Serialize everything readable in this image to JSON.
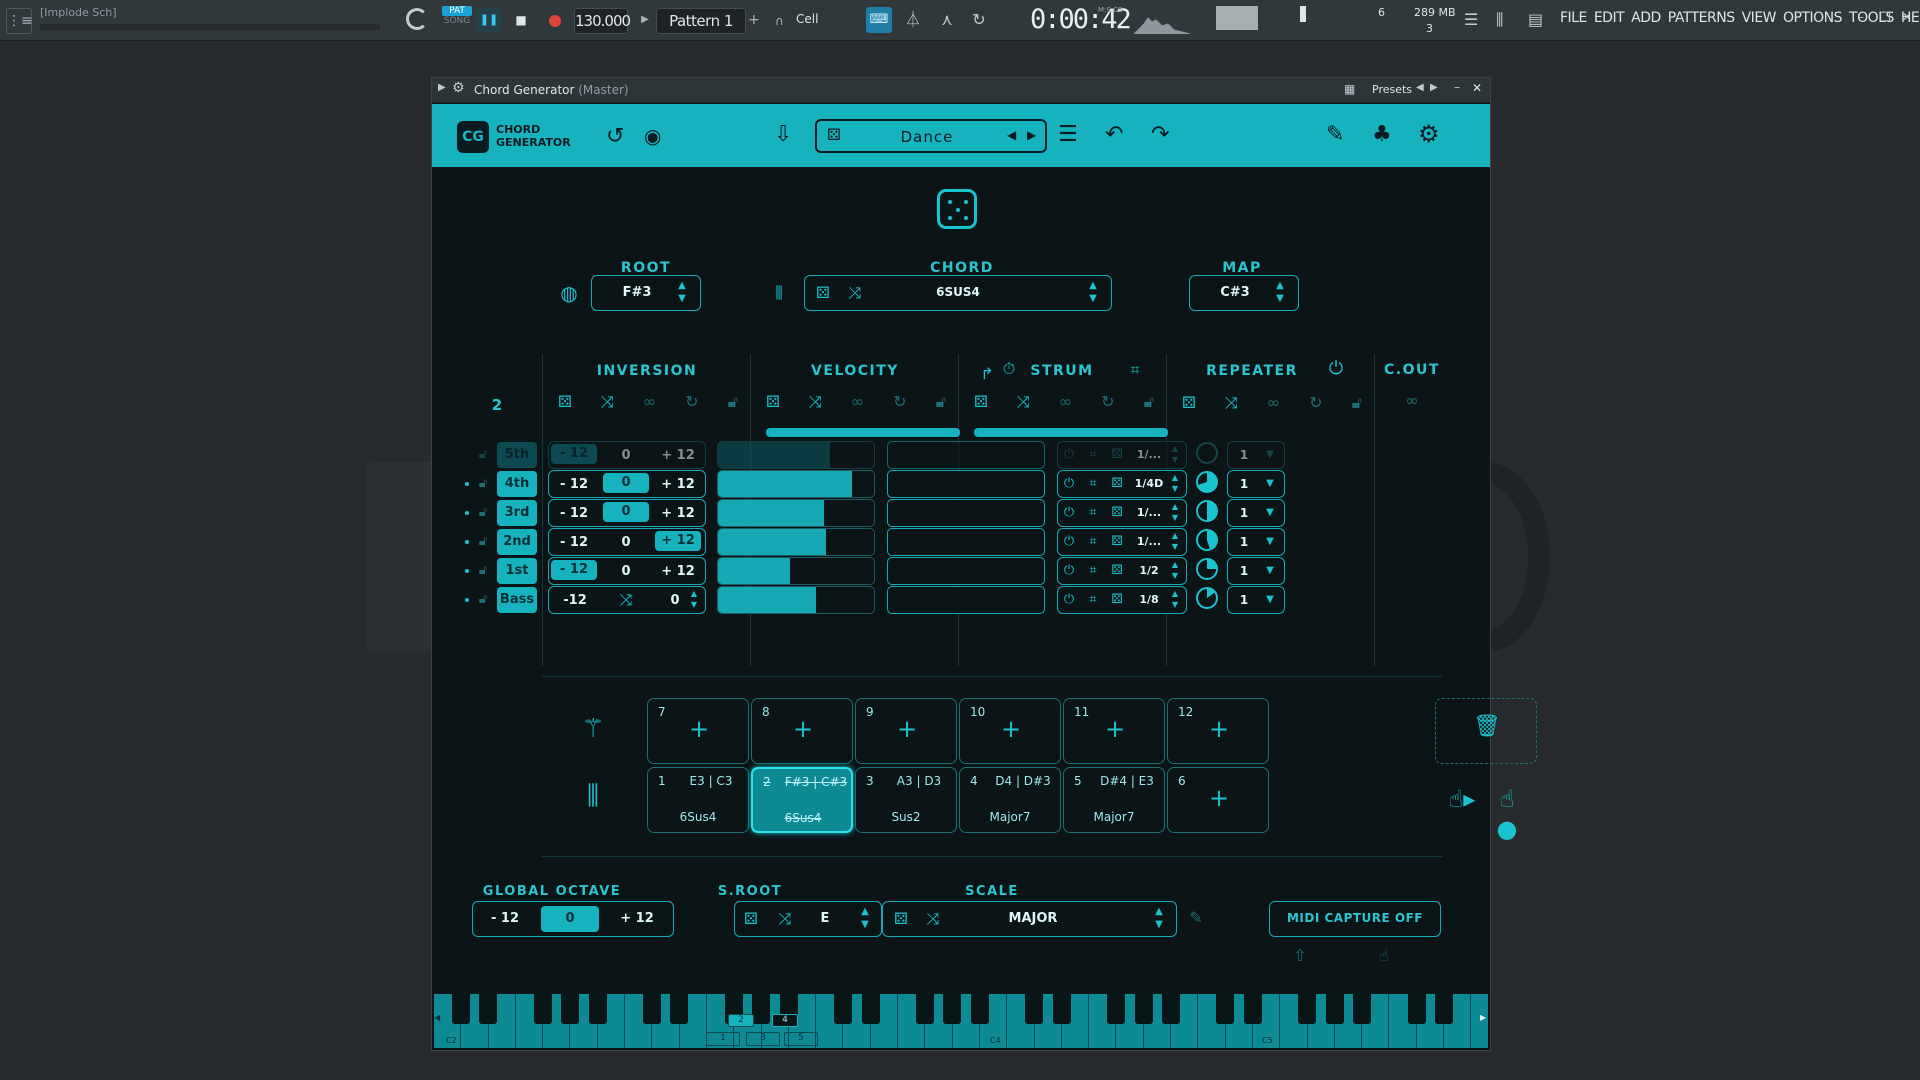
{
  "daw": {
    "title": "[Implode Sch]",
    "pat_label": "PAT",
    "song_label": "SONG",
    "tempo": "130.000",
    "pattern": "Pattern 1",
    "snap": "Cell",
    "time": "0:00:42",
    "time_unit": "M:S:CS",
    "cpu_value": "6",
    "memory": "289 MB",
    "voices": "3",
    "menus": [
      "FILE",
      "EDIT",
      "ADD",
      "PATTERNS",
      "VIEW",
      "OPTIONS",
      "TOOLS",
      "HELP"
    ]
  },
  "window": {
    "title": "Chord Generator",
    "subtitle": "(Master)",
    "presets_label": "Presets"
  },
  "header": {
    "logo_abbr": "CG",
    "logo_line1": "CHORD",
    "logo_line2": "GENERATOR",
    "preset_name": "Dance"
  },
  "controls": {
    "root_label": "ROOT",
    "root_value": "F#3",
    "chord_label": "CHORD",
    "chord_value": "6SUS4",
    "map_label": "MAP",
    "map_value": "C#3"
  },
  "grid": {
    "voice_count": "2",
    "section_labels": {
      "inversion": "INVERSION",
      "velocity": "VELOCITY",
      "strum": "STRUM",
      "repeater": "REPEATER",
      "cout": "C.OUT"
    },
    "rows": [
      {
        "name": "5th",
        "minus": "- 12",
        "zero": "0",
        "plus": "+ 12",
        "selected": "minus",
        "velocity": 0.72,
        "rate": "1/...",
        "cout": "1",
        "active": false,
        "pie": 0.0
      },
      {
        "name": "4th",
        "minus": "- 12",
        "zero": "0",
        "plus": "+ 12",
        "selected": "zero",
        "velocity": 0.86,
        "rate": "1/4D",
        "cout": "1",
        "active": true,
        "pie": 0.7
      },
      {
        "name": "3rd",
        "minus": "- 12",
        "zero": "0",
        "plus": "+ 12",
        "selected": "zero",
        "velocity": 0.68,
        "rate": "1/...",
        "cout": "1",
        "active": true,
        "pie": 0.5
      },
      {
        "name": "2nd",
        "minus": "- 12",
        "zero": "0",
        "plus": "+ 12",
        "selected": "plus",
        "velocity": 0.69,
        "rate": "1/...",
        "cout": "1",
        "active": true,
        "pie": 0.45
      },
      {
        "name": "1st",
        "minus": "- 12",
        "zero": "0",
        "plus": "+ 12",
        "selected": "minus",
        "velocity": 0.46,
        "rate": "1/2",
        "cout": "1",
        "active": true,
        "pie": 0.25
      },
      {
        "name": "Bass",
        "minus": "-12",
        "zero": "",
        "plus": "0",
        "selected": "none",
        "velocity": 0.63,
        "rate": "1/8",
        "cout": "1",
        "active": true,
        "pie": 0.15
      }
    ]
  },
  "pads": {
    "top": [
      {
        "num": "7"
      },
      {
        "num": "8"
      },
      {
        "num": "9"
      },
      {
        "num": "10"
      },
      {
        "num": "11"
      },
      {
        "num": "12"
      }
    ],
    "bottom": [
      {
        "num": "1",
        "notes": "E3 | C3",
        "name": "6Sus4"
      },
      {
        "num": "2",
        "notes": "F#3 | C#3",
        "name": "6Sus4"
      },
      {
        "num": "3",
        "notes": "A3 | D3",
        "name": "Sus2"
      },
      {
        "num": "4",
        "notes": "D4 | D#3",
        "name": "Major7"
      },
      {
        "num": "5",
        "notes": "D#4 | E3",
        "name": "Major7"
      },
      {
        "num": "6",
        "notes": "",
        "name": ""
      }
    ]
  },
  "footer": {
    "global_octave_label": "GLOBAL OCTAVE",
    "oct_minus": "- 12",
    "oct_zero": "0",
    "oct_plus": "+ 12",
    "sroot_label": "S.ROOT",
    "sroot_value": "E",
    "scale_label": "SCALE",
    "scale_value": "MAJOR",
    "midi_capture": "MIDI CAPTURE OFF"
  },
  "keyboard": {
    "c2": "C2",
    "c4": "C4",
    "c5": "C5",
    "markers_top": [
      "2",
      "4"
    ],
    "markers_bottom": [
      "1",
      "3",
      "5"
    ]
  },
  "colors": {
    "accent": "#16b3bf",
    "background": "#0b1416",
    "daw": "#31383c"
  }
}
